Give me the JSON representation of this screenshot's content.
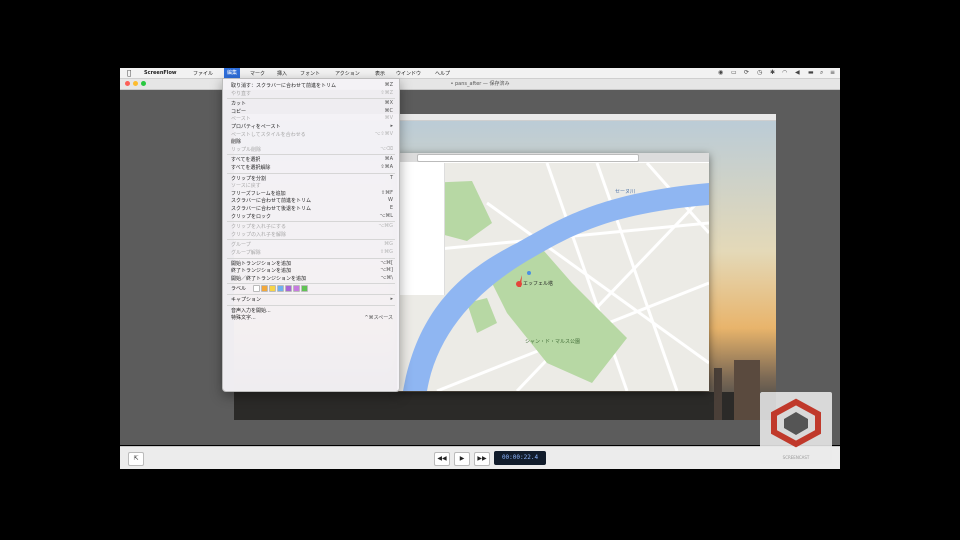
{
  "app": {
    "name": "ScreenFlow",
    "window_title": "• pans_after — 保存済み"
  },
  "menubar": {
    "items": [
      {
        "label": "ScreenFlow"
      },
      {
        "label": "ファイル"
      },
      {
        "label": "編集"
      },
      {
        "label": "マーク"
      },
      {
        "label": "挿入"
      },
      {
        "label": "フォント"
      },
      {
        "label": "アクション"
      },
      {
        "label": "表示"
      },
      {
        "label": "ウインドウ"
      },
      {
        "label": "ヘルプ"
      }
    ],
    "active_index": 2
  },
  "edit_menu": {
    "rows": [
      {
        "label": "取り消す：スクラバーに合わせて前進をトリム",
        "shortcut": "⌘Z",
        "enabled": true
      },
      {
        "label": "やり直す",
        "shortcut": "⇧⌘Z",
        "enabled": false
      },
      {
        "sep": true
      },
      {
        "label": "カット",
        "shortcut": "⌘X",
        "enabled": true
      },
      {
        "label": "コピー",
        "shortcut": "⌘C",
        "enabled": true
      },
      {
        "label": "ペースト",
        "shortcut": "⌘V",
        "enabled": false
      },
      {
        "label": "プロパティをペースト",
        "shortcut": "▸",
        "enabled": true
      },
      {
        "label": "ペーストしてスタイルを合わせる",
        "shortcut": "⌥⇧⌘V",
        "enabled": false
      },
      {
        "label": "削除",
        "shortcut": "",
        "enabled": true
      },
      {
        "label": "リップル削除",
        "shortcut": "⌥⌫",
        "enabled": false
      },
      {
        "sep": true
      },
      {
        "label": "すべてを選択",
        "shortcut": "⌘A",
        "enabled": true
      },
      {
        "label": "すべてを選択解除",
        "shortcut": "⇧⌘A",
        "enabled": true
      },
      {
        "sep": true
      },
      {
        "label": "クリップを分割",
        "shortcut": "T",
        "enabled": true
      },
      {
        "label": "ソースに戻す",
        "shortcut": "",
        "enabled": false
      },
      {
        "label": "フリーズフレームを追加",
        "shortcut": "⇧⌘F",
        "enabled": true
      },
      {
        "label": "スクラバーに合わせて前進をトリム",
        "shortcut": "W",
        "enabled": true
      },
      {
        "label": "スクラバーに合わせて後退をトリム",
        "shortcut": "E",
        "enabled": true
      },
      {
        "label": "クリップをロック",
        "shortcut": "⌥⌘L",
        "enabled": true
      },
      {
        "sep": true
      },
      {
        "label": "クリップを入れ子にする",
        "shortcut": "⌥⌘G",
        "enabled": false
      },
      {
        "label": "クリップの入れ子を解除",
        "shortcut": "",
        "enabled": false
      },
      {
        "sep": true
      },
      {
        "label": "グループ",
        "shortcut": "⌘G",
        "enabled": false
      },
      {
        "label": "グループ解除",
        "shortcut": "⇧⌘G",
        "enabled": false
      },
      {
        "sep": true
      },
      {
        "label": "開始トランジションを追加",
        "shortcut": "⌥⌘[",
        "enabled": true
      },
      {
        "label": "終了トランジションを追加",
        "shortcut": "⌥⌘]",
        "enabled": true
      },
      {
        "label": "開始／終了トランジションを追加",
        "shortcut": "⌥⌘\\",
        "enabled": true
      },
      {
        "sep": true
      },
      {
        "label": "ラベル",
        "shortcut": "",
        "enabled": true,
        "swatches": true
      },
      {
        "sep": true
      },
      {
        "label": "キャプション",
        "shortcut": "▸",
        "enabled": true
      },
      {
        "sep": true
      },
      {
        "label": "音声入力を開始...",
        "shortcut": "",
        "enabled": true
      },
      {
        "label": "特殊文字...",
        "shortcut": "^⌘スペース",
        "enabled": true
      }
    ],
    "label_colors": [
      "#ffffff",
      "#f2a73b",
      "#f7d447",
      "#6fb0ef",
      "#a866d8",
      "#c77be0",
      "#61c354"
    ]
  },
  "map": {
    "labels": [
      "セーヌ川",
      "シャン・ド・マルス公園",
      "エッフェル塔"
    ],
    "colors": {
      "water": "#8fb6f2",
      "park": "#b7d8a4",
      "land": "#ecebe6",
      "road": "#ffffff",
      "marker": "#e4453b"
    }
  },
  "transport": {
    "timecode": "00:00:22.4"
  },
  "logo": {
    "text": "SCREENCAST"
  },
  "colors": {
    "accent": "#2f6fdb",
    "canvas": "#5c5c5c"
  }
}
